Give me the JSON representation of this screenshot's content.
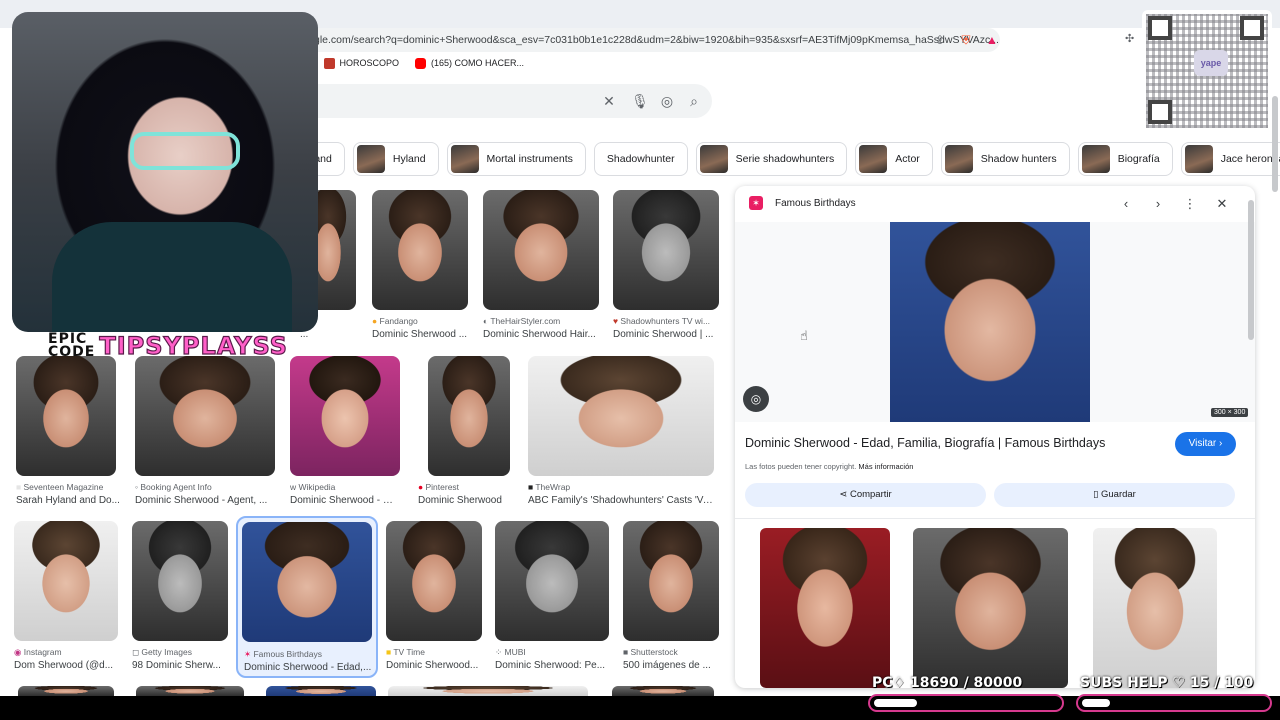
{
  "browser": {
    "url": "gle.com/search?q=dominic+Sherwood&sca_esv=7c031b0b1e1c228d&udm=2&biw=1920&bih=935&sxsrf=AE3TifMj09pKmemsa_haSsdwSYVAzc...",
    "bookmarks": [
      {
        "label": "...",
        "color": "#888888"
      },
      {
        "label": "HOROSCOPO",
        "color": "#c0392b"
      },
      {
        "label": "(165) COMO HACER...",
        "color": "#ff0000"
      }
    ]
  },
  "search": {
    "icons": [
      "close-icon",
      "mic-icon",
      "lens-icon",
      "search-icon"
    ]
  },
  "chips": [
    {
      "label": "land",
      "thumb": false
    },
    {
      "label": "Hyland",
      "thumb": true
    },
    {
      "label": "Mortal instruments",
      "thumb": true
    },
    {
      "label": "Shadowhunter",
      "thumb": false
    },
    {
      "label": "Serie shadowhunters",
      "thumb": true
    },
    {
      "label": "Actor",
      "thumb": true
    },
    {
      "label": "Shadow hunters",
      "thumb": true
    },
    {
      "label": "Biografía",
      "thumb": true
    },
    {
      "label": "Jace herondale",
      "thumb": true
    }
  ],
  "results": {
    "row1": [
      {
        "source": "",
        "title": "..."
      },
      {
        "source": "Fandango",
        "title": "Dominic Sherwood ..."
      },
      {
        "source": "TheHairStyler.com",
        "title": "Dominic Sherwood Hair..."
      },
      {
        "source": "Shadowhunters TV wi...",
        "title": "Dominic Sherwood | ..."
      }
    ],
    "row2": [
      {
        "source": "Seventeen Magazine",
        "title": "Sarah Hyland and Do..."
      },
      {
        "source": "Booking Agent Info",
        "title": "Dominic Sherwood - Agent, ..."
      },
      {
        "source": "Wikipedia",
        "title": "Dominic Sherwood - W..."
      },
      {
        "source": "Pinterest",
        "title": "Dominic Sherwood"
      },
      {
        "source": "TheWrap",
        "title": "ABC Family's 'Shadowhunters' Casts 'Va..."
      }
    ],
    "row3": [
      {
        "source": "Instagram",
        "title": "Dom Sherwood (@d..."
      },
      {
        "source": "Getty Images",
        "title": "98 Dominic Sherw..."
      },
      {
        "source": "Famous Birthdays",
        "title": "Dominic Sherwood - Edad,..."
      },
      {
        "source": "TV Time",
        "title": "Dominic Sherwood..."
      },
      {
        "source": "MUBI",
        "title": "Dominic Sherwood: Pe..."
      },
      {
        "source": "Shutterstock",
        "title": "500 imágenes de ..."
      }
    ]
  },
  "panel": {
    "source": "Famous Birthdays",
    "dimensions": "300 × 300",
    "title": "Dominic Sherwood - Edad, Familia, Biografía | Famous Birthdays",
    "visit_label": "Visitar",
    "copyright": "Las fotos pueden tener copyright.",
    "more_info": "Más información",
    "share_label": "Compartir",
    "save_label": "Guardar"
  },
  "overlay": {
    "logo_line1": "EPIC",
    "logo_line2": "CODE",
    "brand": "TIPSYPLAYSS",
    "qr_brand": "yape",
    "points_label": "PC♢",
    "points_value": "18690",
    "points_goal": "/ 80000",
    "points_progress": 0.234,
    "subs_label": "SUBS HELP ♡",
    "subs_value": "15",
    "subs_goal": "/ 100",
    "subs_progress": 0.15,
    "accent": "#d6398e"
  }
}
